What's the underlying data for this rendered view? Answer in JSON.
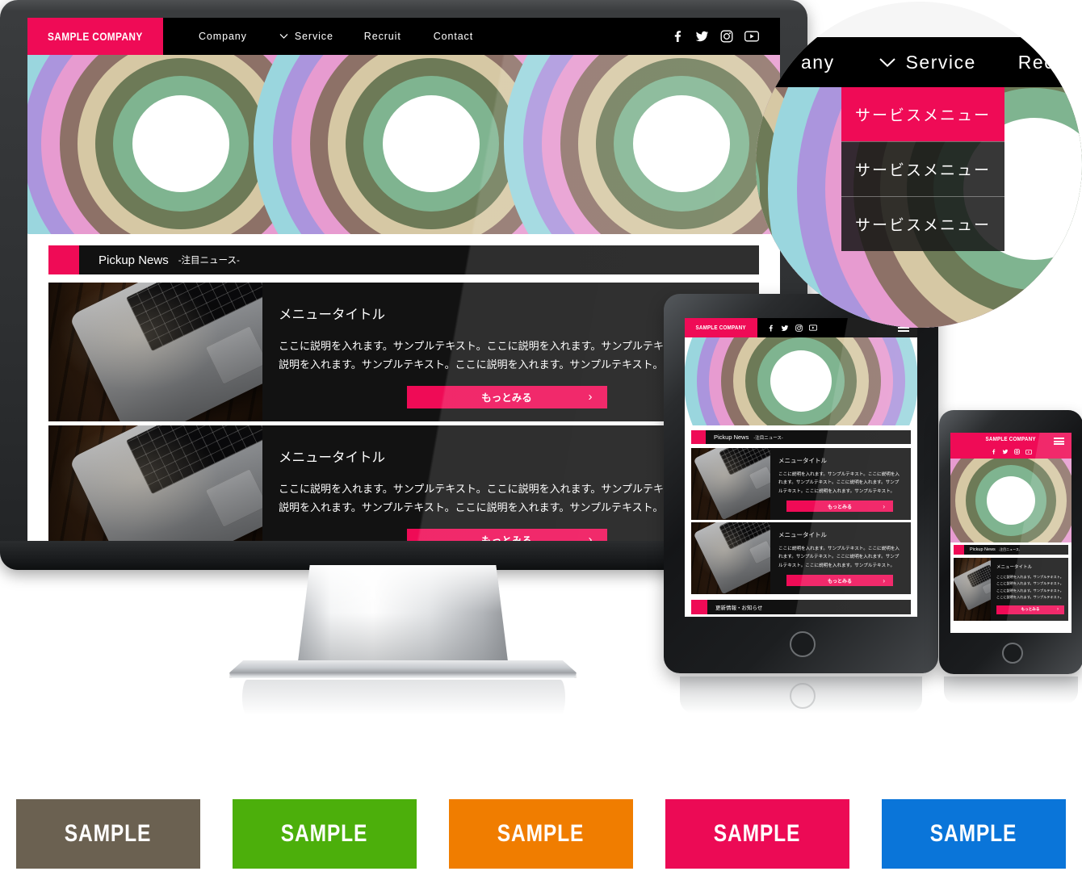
{
  "brand": {
    "name": "SAMPLE COMPANY",
    "accent": "#ef0b56",
    "dark": "#000000",
    "panel": "#121212"
  },
  "desktop": {
    "nav": {
      "logo": "SAMPLE COMPANY",
      "items": [
        {
          "label": "Company",
          "has_dropdown": false
        },
        {
          "label": "Service",
          "has_dropdown": true
        },
        {
          "label": "Recruit",
          "has_dropdown": false
        },
        {
          "label": "Contact",
          "has_dropdown": false
        }
      ],
      "social": [
        {
          "name": "facebook-icon",
          "glyph": "f"
        },
        {
          "name": "twitter-icon",
          "glyph": "t"
        },
        {
          "name": "instagram-icon",
          "glyph": "i"
        },
        {
          "name": "youtube-icon",
          "glyph": "y"
        }
      ]
    },
    "pickup": {
      "title_en": "Pickup News",
      "title_jp": "-注目ニュース-"
    },
    "cards": [
      {
        "title": "メニュータイトル",
        "text": "ここに説明を入れます。サンプルテキスト。ここに説明を入れます。サンプルテキスト。ここに説明を入れます。サンプルテキスト。ここに説明を入れます。サンプルテキスト。",
        "button": "もっとみる",
        "chevron": "›",
        "image": "laptop-on-desk-photo"
      },
      {
        "title": "メニュータイトル",
        "text": "ここに説明を入れます。サンプルテキスト。ここに説明を入れます。サンプルテキスト。ここに説明を入れます。サンプルテキスト。ここに説明を入れます。サンプルテキスト。",
        "button": "もっとみる",
        "chevron": "›",
        "image": "laptop-on-desk-photo"
      }
    ]
  },
  "magnifier": {
    "nav_items": [
      "any",
      "Service",
      "Recruit"
    ],
    "chevron": "⌄",
    "dropdown": [
      {
        "label": "サービスメニュー",
        "state": "active"
      },
      {
        "label": "サービスメニュー",
        "state": "normal"
      },
      {
        "label": "サービスメニュー",
        "state": "normal"
      }
    ]
  },
  "tablet": {
    "logo": "SAMPLE COMPANY",
    "menu_icon": "hamburger-icon",
    "social": [
      "facebook-icon",
      "twitter-icon",
      "instagram-icon",
      "youtube-icon"
    ],
    "pickup": {
      "title_en": "Pickup News",
      "title_jp": "-注目ニュース-"
    },
    "cards": [
      {
        "title": "メニュータイトル",
        "text": "ここに説明を入れます。サンプルテキスト。ここに説明を入れます。サンプルテキスト。ここに説明を入れます。サンプルテキスト。ここに説明を入れます。サンプルテキスト。",
        "button": "もっとみる",
        "chevron": "›"
      },
      {
        "title": "メニュータイトル",
        "text": "ここに説明を入れます。サンプルテキスト。ここに説明を入れます。サンプルテキスト。ここに説明を入れます。サンプルテキスト。ここに説明を入れます。サンプルテキスト。",
        "button": "もっとみる",
        "chevron": "›"
      }
    ],
    "news_section": "更新情報・お知らせ"
  },
  "phone": {
    "logo": "SAMPLE COMPANY",
    "menu_icon": "hamburger-icon",
    "social": [
      "facebook-icon",
      "twitter-icon",
      "instagram-icon",
      "youtube-icon"
    ],
    "pickup": {
      "title_en": "Pickup News",
      "title_jp": "-注目ニュース-"
    },
    "card": {
      "title": "メニュータイトル",
      "text": "ここに説明を入れます。サンプルテキスト。ここに説明を入れます。サンプルテキスト。ここに説明を入れます。サンプルテキスト。ここに説明を入れます。サンプルテキスト。",
      "button": "もっとみる",
      "chevron": "›"
    }
  },
  "swatches": [
    {
      "label": "SAMPLE",
      "color": "#6b6151"
    },
    {
      "label": "SAMPLE",
      "color": "#4caf0b"
    },
    {
      "label": "SAMPLE",
      "color": "#f07d00"
    },
    {
      "label": "SAMPLE",
      "color": "#ec0a55"
    },
    {
      "label": "SAMPLE",
      "color": "#0a75d9"
    }
  ],
  "ring_colors": [
    "#9ad6de",
    "#ab95dd",
    "#e79bd0",
    "#8d7167",
    "#d6c8a4",
    "#6d7a57",
    "#7fb490",
    "#ffffff"
  ]
}
